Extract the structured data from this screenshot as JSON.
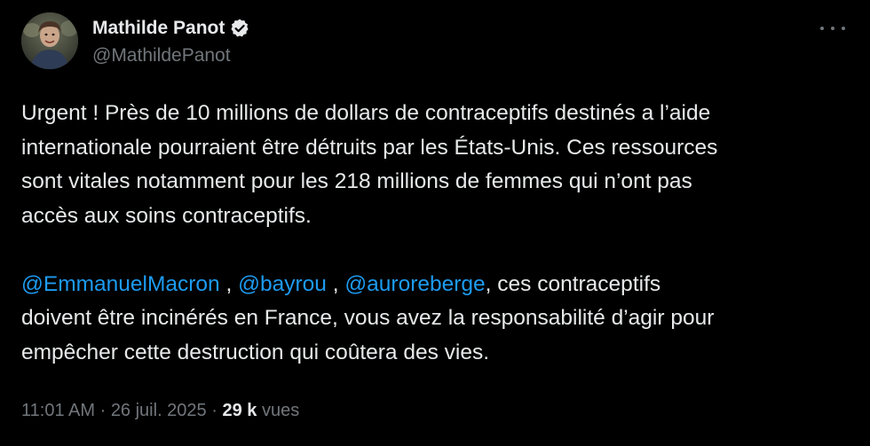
{
  "author": {
    "display_name": "Mathilde Panot",
    "handle": "@MathildePanot",
    "verified": true,
    "verified_color": "#1d9bf0"
  },
  "tweet": {
    "paragraph1_lines": [
      "Urgent ! Près de 10 millions de dollars de contraceptifs destinés a l’aide",
      "internationale pourraient être détruits par les États-Unis. Ces ressources",
      "sont vitales notamment pour les 218 millions de femmes qui n’ont pas",
      "accès aux soins contraceptifs."
    ],
    "mentions": [
      "@EmmanuelMacron",
      "@bayrou",
      "@auroreberge"
    ],
    "mention_separator": " , ",
    "mention_tail": ", ces contraceptifs",
    "paragraph2_lines": [
      "doivent être incinérés en France, vous avez la responsabilité d’agir pour",
      "empêcher cette destruction qui coûtera des vies."
    ]
  },
  "meta": {
    "time": "11:01 AM",
    "separator": " · ",
    "date": "26 juil. 2025",
    "views_count": "29 k",
    "views_label": " vues"
  },
  "colors": {
    "background": "#000000",
    "text": "#e7e9ea",
    "muted": "#71767b",
    "link": "#1d9bf0"
  },
  "icons": {
    "verified": "verified-badge-icon",
    "more": "more-options-icon"
  }
}
